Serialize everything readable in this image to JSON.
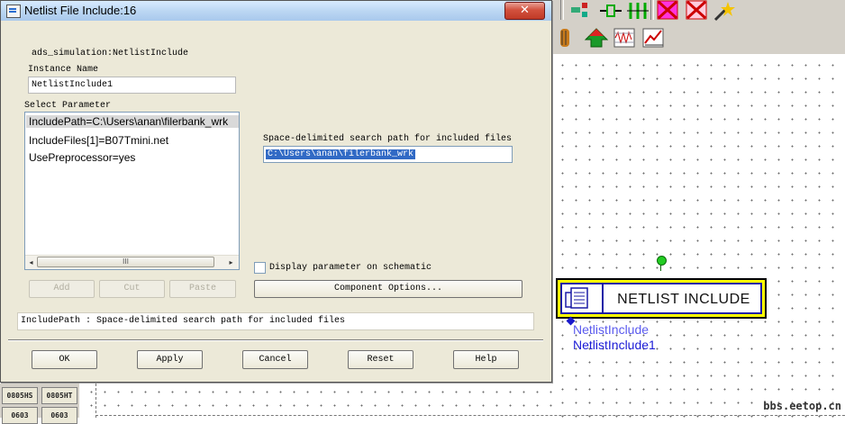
{
  "dialog": {
    "title": "Netlist File Include:16",
    "close_glyph": "✕",
    "component_type": "ads_simulation:NetlistInclude",
    "instance_name_label": "Instance Name",
    "instance_name_value": "NetlistInclude1",
    "select_parameter_label": "Select Parameter",
    "parameters": [
      "IncludePath=C:\\Users\\anan\\filerbank_wrk",
      "IncludeFiles[1]=B07Tmini.net",
      "UsePreprocessor=yes"
    ],
    "selected_parameter_index": 0,
    "add_label": "Add",
    "cut_label": "Cut",
    "paste_label": "Paste",
    "field_label": "Space-delimited search path for included files",
    "field_value": "C:\\Users\\anan\\filerbank_wrk",
    "display_checkbox_label": "Display parameter on schematic",
    "display_checked": false,
    "component_options_label": "Component Options...",
    "help_line": "IncludePath : Space-delimited search path for included files",
    "ok_label": "OK",
    "apply_label": "Apply",
    "cancel_label": "Cancel",
    "reset_label": "Reset",
    "help_label": "Help",
    "scroll_left_glyph": "◂",
    "scroll_right_glyph": "▸",
    "scroll_grip_glyph": "III"
  },
  "schematic": {
    "component_title": "NETLIST INCLUDE",
    "component_name": "NetlistInclude",
    "instance_name": "NetlistInclude1",
    "palette_items": [
      "0805HS",
      "0805HT",
      "0603",
      "0603"
    ],
    "watermark": "bbs.eetop.cn"
  },
  "colors": {
    "selection": "#316ac5",
    "component_fill": "#ffff00",
    "component_border": "#1a1aa6",
    "close_button": "#c03a26"
  }
}
